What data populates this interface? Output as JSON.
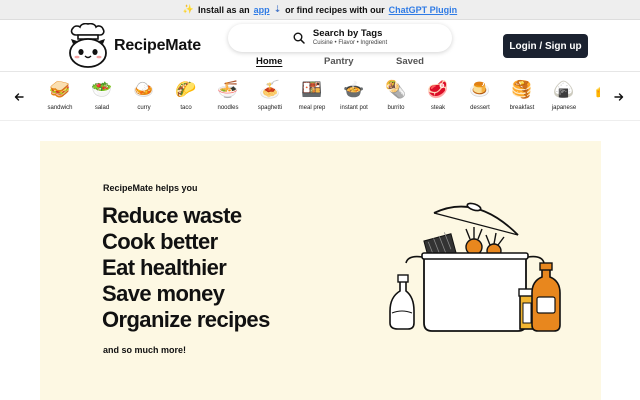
{
  "announcement": {
    "icon": "sparkle-icon",
    "text_before": "Install as an",
    "app_link": "app",
    "text_after": "or find recipes with our",
    "plugin_link": "ChatGPT Plugin",
    "link_color": "#2f7be5"
  },
  "header": {
    "brand_name": "RecipeMate",
    "search_title": "Search by Tags",
    "search_subtitle": "Cuisine • Flavor • Ingredient",
    "tabs": [
      {
        "label": "Home",
        "active": true
      },
      {
        "label": "Pantry",
        "active": false
      },
      {
        "label": "Saved",
        "active": false
      }
    ],
    "login_label": "Login / Sign up",
    "login_color": "#1b2230"
  },
  "categories": [
    {
      "emoji": "🥪",
      "label": "sandwich"
    },
    {
      "emoji": "🥗",
      "label": "salad"
    },
    {
      "emoji": "🍛",
      "label": "curry"
    },
    {
      "emoji": "🌮",
      "label": "taco"
    },
    {
      "emoji": "🍜",
      "label": "noodles"
    },
    {
      "emoji": "🍝",
      "label": "spaghetti"
    },
    {
      "emoji": "🍱",
      "label": "meal prep"
    },
    {
      "emoji": "🍲",
      "label": "instant pot"
    },
    {
      "emoji": "🌯",
      "label": "burrito"
    },
    {
      "emoji": "🥩",
      "label": "steak"
    },
    {
      "emoji": "🍮",
      "label": "dessert"
    },
    {
      "emoji": "🥞",
      "label": "breakfast"
    },
    {
      "emoji": "🍙",
      "label": "japanese"
    },
    {
      "emoji": "🧀",
      "label": "ch"
    }
  ],
  "hero": {
    "kicker": "RecipeMate helps you",
    "lines": [
      "Reduce waste",
      "Cook better",
      "Eat healthier",
      "Save money",
      "Organize recipes"
    ],
    "more": "and so much more!",
    "background": "#fdf8e3"
  }
}
